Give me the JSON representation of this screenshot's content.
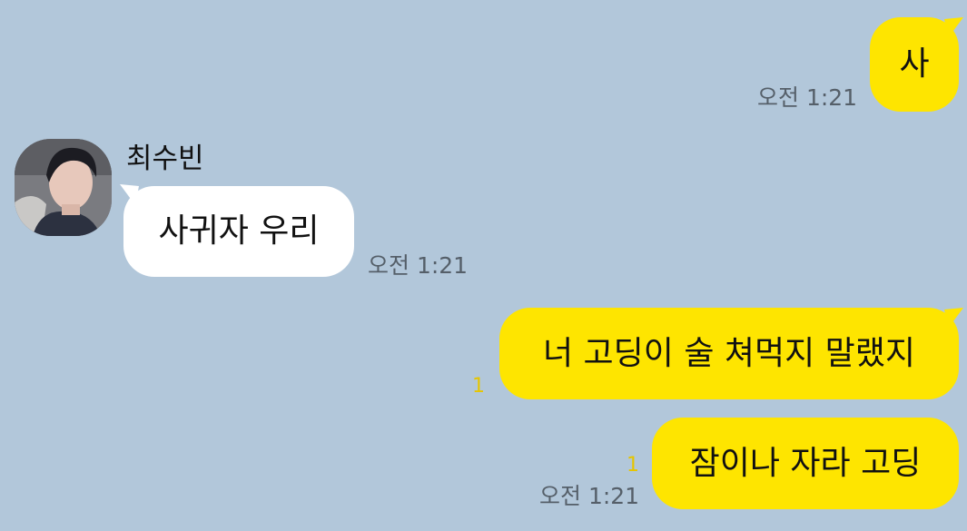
{
  "contact": {
    "name": "최수빈"
  },
  "messages": [
    {
      "side": "out",
      "text": "사",
      "time": "오전 1:21",
      "unread": ""
    },
    {
      "side": "in",
      "text": "사귀자 우리",
      "time": "오전 1:21",
      "unread": ""
    },
    {
      "side": "out",
      "text": "너 고딩이 술 쳐먹지 말랬지",
      "time": "",
      "unread": "1"
    },
    {
      "side": "out",
      "text": "잠이나 자라 고딩",
      "time": "오전 1:21",
      "unread": "1"
    }
  ],
  "colors": {
    "chat_background": "#b2c7da",
    "outgoing_bubble": "#fee500",
    "incoming_bubble": "#ffffff",
    "timestamp": "#555f69",
    "unread_count": "#e6c500"
  },
  "icons": {
    "avatar": "profile-photo"
  }
}
